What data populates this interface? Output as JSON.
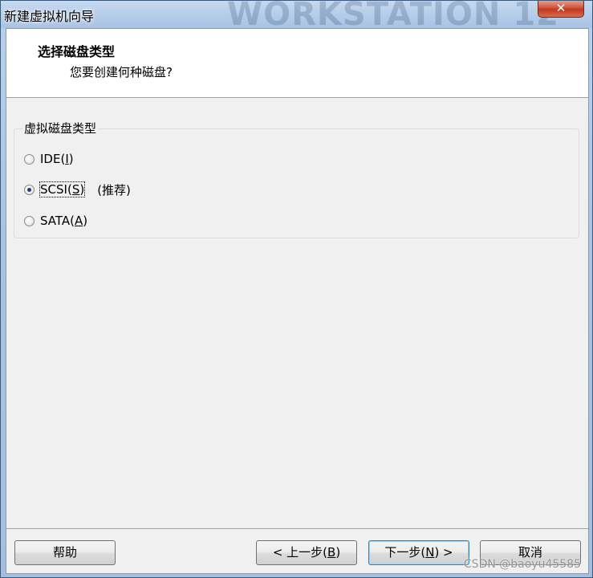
{
  "window": {
    "title": "新建虚拟机向导",
    "watermark": "WORKSTATION 12",
    "close_symbol": "✕"
  },
  "header": {
    "title": "选择磁盘类型",
    "subtitle": "您要创建何种磁盘?"
  },
  "group": {
    "label": "虚拟磁盘类型",
    "options": [
      {
        "name": "IDE",
        "paren_open": "(",
        "mnemonic": "I",
        "paren_close": ")",
        "note": "",
        "checked": false
      },
      {
        "name": "SCSI",
        "paren_open": "(",
        "mnemonic": "S",
        "paren_close": ")",
        "note": "(推荐)",
        "checked": true
      },
      {
        "name": "SATA",
        "paren_open": "(",
        "mnemonic": "A",
        "paren_close": ")",
        "note": "",
        "checked": false
      }
    ]
  },
  "buttons": {
    "help": "帮助",
    "back_prefix": "< 上一步(",
    "back_mnemonic": "B",
    "back_suffix": ")",
    "next_prefix": "下一步(",
    "next_mnemonic": "N",
    "next_suffix": ") >",
    "cancel": "取消"
  },
  "overlay": {
    "credit": "CSDN @baoyu45585"
  }
}
